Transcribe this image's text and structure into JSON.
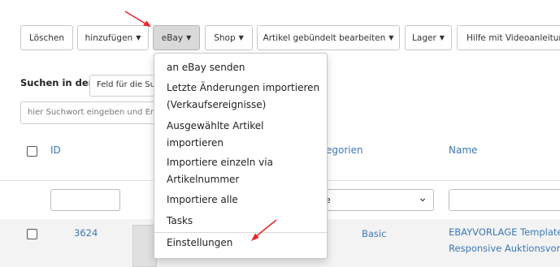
{
  "toolbar": {
    "buttons": [
      {
        "label": "Löschen"
      },
      {
        "label": "hinzufügen"
      },
      {
        "label": "eBay"
      },
      {
        "label": "Shop"
      },
      {
        "label": "Artikel gebündelt bearbeiten"
      },
      {
        "label": "Lager"
      },
      {
        "label": "Hilfe mit Videoanleitung"
      }
    ],
    "caret": "▼"
  },
  "search": {
    "label": "Suchen in der",
    "field_select": "Feld für die Su",
    "input_placeholder": "hier Suchwort eingeben und Ent"
  },
  "table": {
    "headers": {
      "id": "ID",
      "categories": "egorien",
      "name": "Name"
    },
    "category_filter_value": "le",
    "filter_select_caret": "⌄",
    "rows": [
      {
        "id": "3624",
        "category": "Basic",
        "name_line1": "EBAYVORLAGE Template",
        "name_line2": "Responsive Auktionsvorl"
      }
    ]
  },
  "ebay_menu": {
    "items": [
      "an eBay senden",
      "Letzte Änderungen importieren",
      "(Verkaufsereignisse)",
      "Ausgewählte Artikel",
      "importieren",
      "Importiere einzeln via",
      "Artikelnummer",
      "Importiere alle",
      "Tasks",
      "Einstellungen"
    ]
  },
  "colors": {
    "link": "#3a78b5",
    "annotation_arrow": "#e8262b",
    "active_button": "#d9d9d9"
  }
}
